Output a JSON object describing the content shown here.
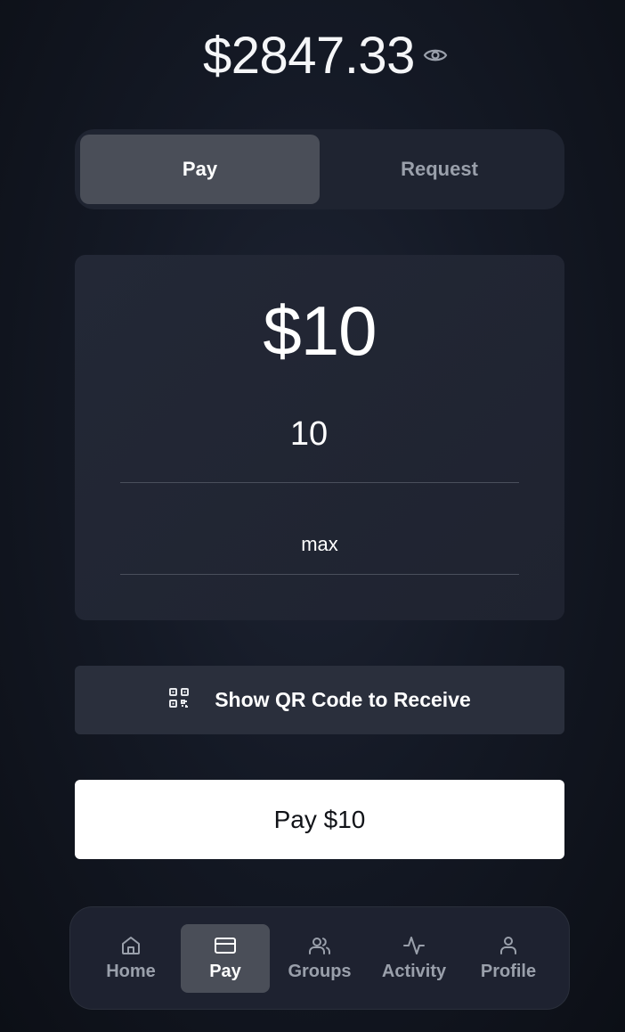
{
  "balance": {
    "amount": "$2847.33",
    "visibility_icon": "eye-icon"
  },
  "mode_tabs": [
    {
      "label": "Pay",
      "active": true
    },
    {
      "label": "Request",
      "active": false
    }
  ],
  "amount_card": {
    "display_amount": "$10",
    "input_value": "10",
    "max_label": "max"
  },
  "qr_button": {
    "icon": "qr-code-icon",
    "label": "Show QR Code to Receive"
  },
  "pay_button": {
    "label": "Pay $10"
  },
  "bottom_nav": [
    {
      "label": "Home",
      "icon": "home-icon",
      "active": false
    },
    {
      "label": "Pay",
      "icon": "credit-card-icon",
      "active": true
    },
    {
      "label": "Groups",
      "icon": "users-icon",
      "active": false
    },
    {
      "label": "Activity",
      "icon": "activity-icon",
      "active": false
    },
    {
      "label": "Profile",
      "icon": "user-icon",
      "active": false
    }
  ],
  "colors": {
    "background": "#141925",
    "card": "#232836",
    "active_tab": "#4a4e58",
    "inactive_text": "#9aa0ab",
    "primary_button": "#ffffff"
  }
}
